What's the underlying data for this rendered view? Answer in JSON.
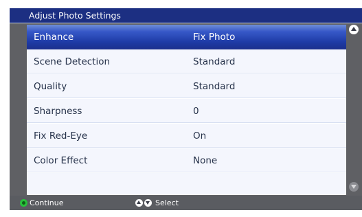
{
  "title": "Adjust Photo Settings",
  "settings": [
    {
      "label": "Enhance",
      "value": "Fix Photo",
      "selected": true
    },
    {
      "label": "Scene Detection",
      "value": "Standard"
    },
    {
      "label": "Quality",
      "value": "Standard"
    },
    {
      "label": "Sharpness",
      "value": "0"
    },
    {
      "label": "Fix Red-Eye",
      "value": "On"
    },
    {
      "label": "Color Effect",
      "value": "None"
    }
  ],
  "footer": {
    "continue_label": "Continue",
    "select_label": "Select"
  },
  "icons": {
    "continue": "ok-button-icon",
    "select": "up-down-arrows-icon",
    "scroll_up": "scroll-up-icon",
    "scroll_down": "scroll-down-icon"
  },
  "colors": {
    "title_bar": "#1c2f82",
    "selection": "#2a47b6",
    "panel": "#f4f6fd",
    "frame": "#5f6064",
    "ok_button": "#27c13b"
  }
}
